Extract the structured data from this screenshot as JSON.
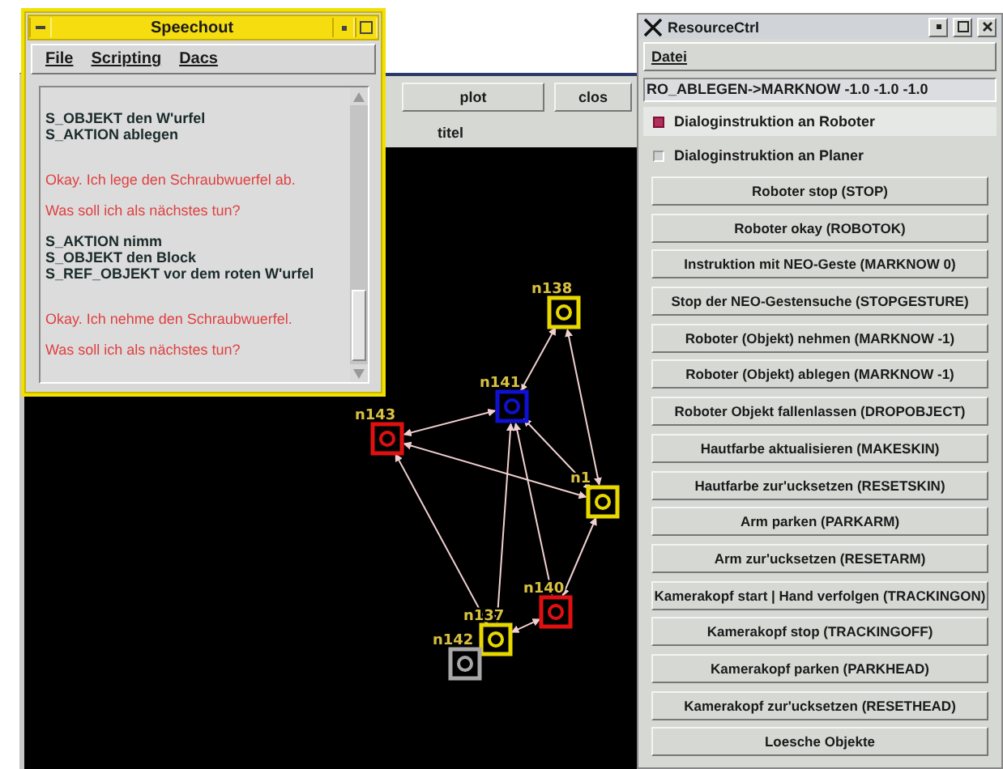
{
  "speechout": {
    "title": "Speechout",
    "menu": [
      "File",
      "Scripting",
      "Dacs"
    ],
    "lines": [
      {
        "kind": "command",
        "text": "S_OBJEKT den  W'urfel"
      },
      {
        "kind": "command",
        "text": "S_AKTION ablegen"
      },
      {
        "kind": "reply",
        "text": "Okay. Ich lege den Schraubwuerfel ab."
      },
      {
        "kind": "reply",
        "text": "Was soll ich als nächstes tun?"
      },
      {
        "kind": "command",
        "text": "S_AKTION nimm"
      },
      {
        "kind": "command",
        "text": "S_OBJEKT den  Block"
      },
      {
        "kind": "command",
        "text": "S_REF_OBJEKT vor  dem  roten  W'urfel"
      },
      {
        "kind": "reply",
        "text": "Okay. Ich nehme den Schraubwuerfel."
      },
      {
        "kind": "reply",
        "text": "Was soll ich als nächstes tun?"
      }
    ]
  },
  "plot_window": {
    "buttons": [
      "plot",
      "clos"
    ],
    "label": "titel",
    "nodes": [
      {
        "label": "n138",
        "color": "#e8d800"
      },
      {
        "label": "n141",
        "color": "#1010d0"
      },
      {
        "label": "n143",
        "color": "#e01010"
      },
      {
        "label": "n1",
        "color": "#e8d800"
      },
      {
        "label": "n140",
        "color": "#e01010"
      },
      {
        "label": "n137",
        "color": "#e8d800"
      },
      {
        "label": "n142",
        "color": "#a8a8a8"
      }
    ]
  },
  "resource_ctrl": {
    "title": "ResourceCtrl",
    "menu": [
      "Datei"
    ],
    "field": "RO_ABLEGEN->MARKNOW -1.0 -1.0 -1.0",
    "options": [
      {
        "label": "Dialoginstruktion an Roboter",
        "checked": true
      },
      {
        "label": "Dialoginstruktion an Planer",
        "checked": false
      }
    ],
    "buttons": [
      "Roboter stop (STOP)",
      "Roboter okay (ROBOTOK)",
      "Instruktion mit NEO-Geste (MARKNOW 0)",
      "Stop der NEO-Gestensuche (STOPGESTURE)",
      "Roboter (Objekt) nehmen (MARKNOW -1)",
      "Roboter (Objekt) ablegen (MARKNOW -1)",
      "Roboter Objekt fallenlassen (DROPOBJECT)",
      "Hautfarbe aktualisieren (MAKESKIN)",
      "Hautfarbe zur'ucksetzen (RESETSKIN)",
      "Arm parken (PARKARM)",
      "Arm zur'ucksetzen (RESETARM)",
      "Kamerakopf start | Hand verfolgen (TRACKINGON)",
      "Kamerakopf stop (TRACKINGOFF)",
      "Kamerakopf parken (PARKHEAD)",
      "Kamerakopf zur'ucksetzen (RESETHEAD)",
      "Loesche Objekte"
    ]
  }
}
